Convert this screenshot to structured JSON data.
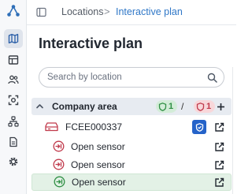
{
  "breadcrumb": {
    "parent": "Locations",
    "separator": ">",
    "current": "Interactive plan"
  },
  "page": {
    "title": "Interactive plan"
  },
  "search": {
    "placeholder": "Search by location",
    "value": ""
  },
  "tree": {
    "area": {
      "label": "Company area",
      "ok_count": "1",
      "separator": "/",
      "alert_count": "1"
    },
    "device": {
      "label": "FCEE000337"
    },
    "sensors": [
      {
        "label": "Open sensor",
        "status": "alert",
        "highlighted": false
      },
      {
        "label": "Open sensor",
        "status": "alert",
        "highlighted": false
      },
      {
        "label": "Open sensor",
        "status": "ok",
        "highlighted": true
      }
    ]
  },
  "colors": {
    "accent": "#2f77c7",
    "ok": "#2f8f44",
    "alert": "#c0394b",
    "shield_button": "#2563c9",
    "rail_active": "#dfe4ec"
  },
  "icons": {
    "rail": [
      "app-logo-icon",
      "map-icon",
      "dashboard-icon",
      "users-icon",
      "scan-icon",
      "network-icon",
      "document-icon",
      "settings-icon"
    ],
    "row_actions": [
      "shield-check-icon",
      "open-external-icon"
    ]
  }
}
